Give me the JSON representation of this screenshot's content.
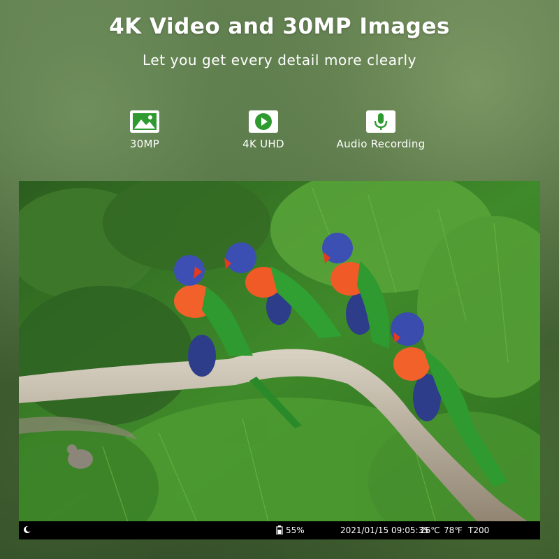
{
  "headline": "4K Video and 30MP Images",
  "subline": "Let you get every detail more clearly",
  "features": [
    {
      "label": "30MP",
      "icon": "image-icon"
    },
    {
      "label": "4K UHD",
      "icon": "play-icon"
    },
    {
      "label": "Audio Recording",
      "icon": "microphone-icon"
    }
  ],
  "status": {
    "battery": "55%",
    "datetime": "2021/01/15 09:05:35",
    "temp_c": "26℃",
    "temp_f": "78℉",
    "camera_id": "T200"
  },
  "colors": {
    "accent_green": "#2f9a2f",
    "statusbar": "#000000"
  }
}
